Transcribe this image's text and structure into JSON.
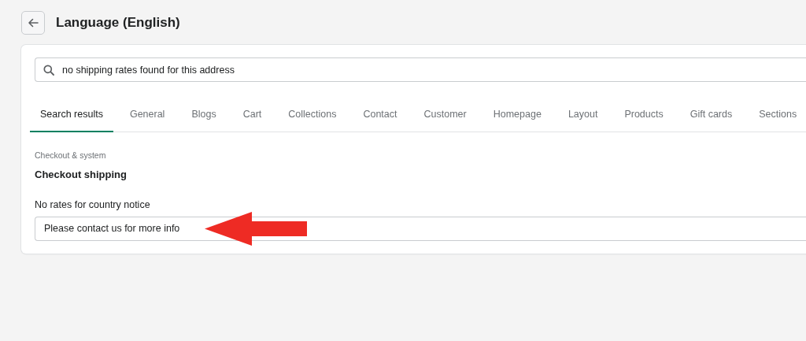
{
  "header": {
    "title": "Language (English)"
  },
  "search": {
    "value": "no shipping rates found for this address"
  },
  "tabs": [
    {
      "label": "Search results",
      "selected": true
    },
    {
      "label": "General",
      "selected": false
    },
    {
      "label": "Blogs",
      "selected": false
    },
    {
      "label": "Cart",
      "selected": false
    },
    {
      "label": "Collections",
      "selected": false
    },
    {
      "label": "Contact",
      "selected": false
    },
    {
      "label": "Customer",
      "selected": false
    },
    {
      "label": "Homepage",
      "selected": false
    },
    {
      "label": "Layout",
      "selected": false
    },
    {
      "label": "Products",
      "selected": false
    },
    {
      "label": "Gift cards",
      "selected": false
    },
    {
      "label": "Sections",
      "selected": false
    }
  ],
  "section": {
    "category": "Checkout & system",
    "title": "Checkout shipping",
    "fields": [
      {
        "label": "No rates for country notice",
        "value": "Please contact us for more info"
      }
    ]
  }
}
